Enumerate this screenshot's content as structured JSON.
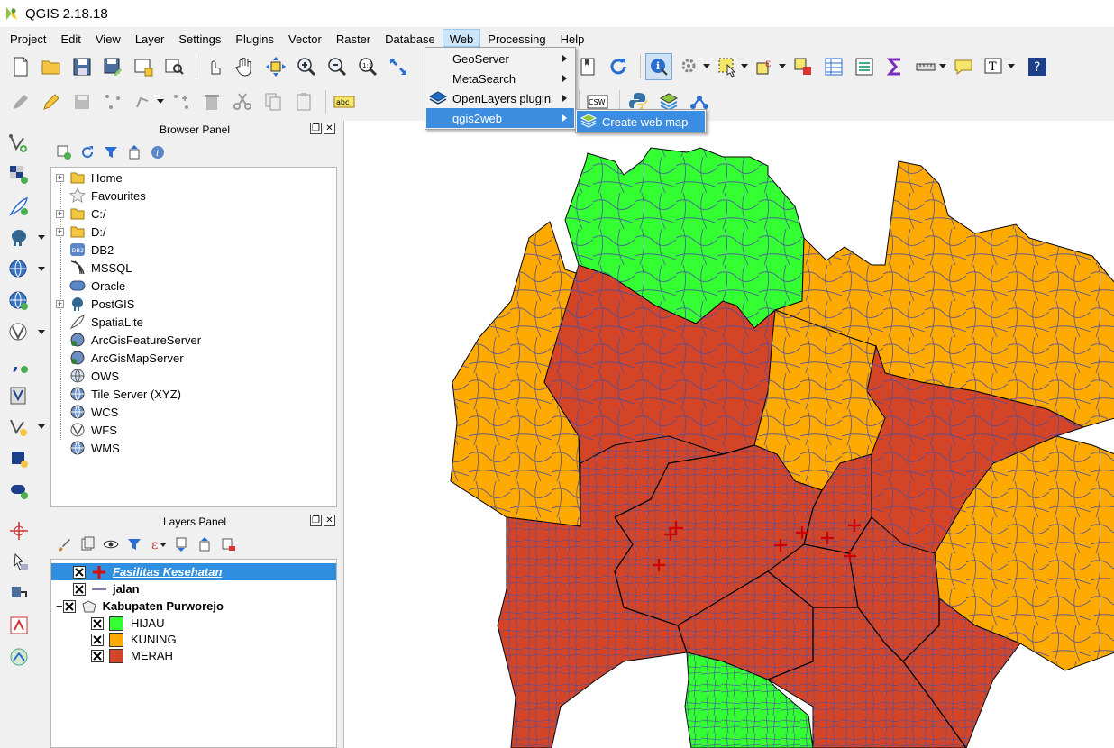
{
  "window": {
    "title": "QGIS 2.18.18"
  },
  "menubar": [
    "Project",
    "Edit",
    "View",
    "Layer",
    "Settings",
    "Plugins",
    "Vector",
    "Raster",
    "Database",
    "Web",
    "Processing",
    "Help"
  ],
  "web_menu": {
    "items": [
      {
        "label": "GeoServer",
        "has_submenu": true
      },
      {
        "label": "MetaSearch",
        "has_submenu": true
      },
      {
        "label": "OpenLayers plugin",
        "has_submenu": true
      },
      {
        "label": "qgis2web",
        "has_submenu": true
      }
    ],
    "submenu": {
      "label": "Create web map"
    }
  },
  "browser_panel": {
    "title": "Browser Panel",
    "items": [
      {
        "label": "Home",
        "icon": "folder-icon",
        "expandable": true
      },
      {
        "label": "Favourites",
        "icon": "star-icon",
        "expandable": false
      },
      {
        "label": "C:/",
        "icon": "folder-icon",
        "expandable": true
      },
      {
        "label": "D:/",
        "icon": "folder-icon",
        "expandable": true
      },
      {
        "label": "DB2",
        "icon": "db2-icon",
        "expandable": false
      },
      {
        "label": "MSSQL",
        "icon": "mssql-icon",
        "expandable": false
      },
      {
        "label": "Oracle",
        "icon": "oracle-icon",
        "expandable": false
      },
      {
        "label": "PostGIS",
        "icon": "postgis-elephant-icon",
        "expandable": true
      },
      {
        "label": "SpatiaLite",
        "icon": "spatialite-feather-icon",
        "expandable": false
      },
      {
        "label": "ArcGisFeatureServer",
        "icon": "arcgis-globe-icon",
        "expandable": false
      },
      {
        "label": "ArcGisMapServer",
        "icon": "arcgis-globe-icon",
        "expandable": false
      },
      {
        "label": "OWS",
        "icon": "ows-globe-icon",
        "expandable": false
      },
      {
        "label": "Tile Server (XYZ)",
        "icon": "globe-icon",
        "expandable": false
      },
      {
        "label": "WCS",
        "icon": "wcs-globe-icon",
        "expandable": false
      },
      {
        "label": "WFS",
        "icon": "wfs-globe-icon",
        "expandable": false
      },
      {
        "label": "WMS",
        "icon": "wms-globe-icon",
        "expandable": false
      }
    ],
    "tree_badge": "DB2"
  },
  "layers_panel": {
    "title": "Layers Panel",
    "layers": [
      {
        "label": "Fasilitas Kesehatan",
        "selected": true,
        "checked": true
      },
      {
        "label": "jalan",
        "checked": true
      },
      {
        "label": "Kabupaten Purworejo",
        "checked": true
      }
    ],
    "classes": [
      {
        "label": "HIJAU",
        "color": "#33ff33"
      },
      {
        "label": "KUNING",
        "color": "#ffaa00"
      },
      {
        "label": "MERAH",
        "color": "#d44527"
      }
    ]
  },
  "toolbar": {
    "label_tool_text": "abc",
    "csw_text": "CSW"
  },
  "colors": {
    "hijau": "#33ff33",
    "kuning": "#ffaa00",
    "merah": "#d44527",
    "road": "#4f4f9e",
    "highlight": "#3c8de0"
  }
}
